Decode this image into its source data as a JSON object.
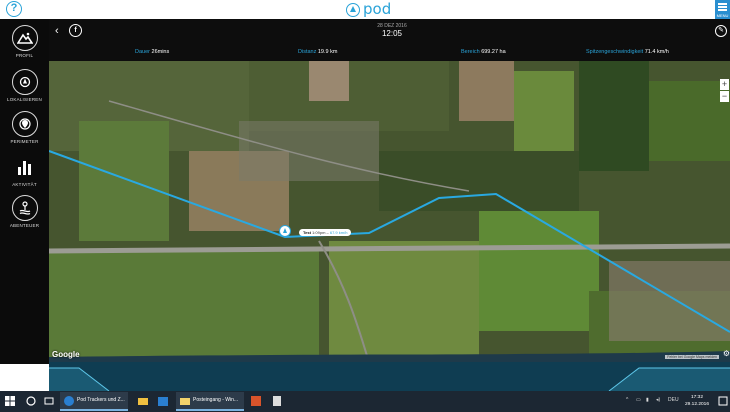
{
  "header": {
    "help_icon": "?",
    "brand": "pod",
    "menu_label": "MENU"
  },
  "sidebar": {
    "items": [
      {
        "label": "PROFIL",
        "icon": "profile-mountain-icon"
      },
      {
        "label": "LOKALISIEREN",
        "icon": "locate-pin-icon"
      },
      {
        "label": "PERIMETER",
        "icon": "perimeter-icon"
      },
      {
        "label": "AKTIVITÄT",
        "icon": "activity-bars-icon"
      },
      {
        "label": "ABENTEUER",
        "icon": "adventure-icon"
      }
    ]
  },
  "detail": {
    "back_icon": "‹",
    "share_icon": "f",
    "date": "28 DEZ 2016",
    "time": "12:05",
    "edit_icon": "✎",
    "stats": [
      {
        "label": "Dauer",
        "value": "26mins"
      },
      {
        "label": "Distanz",
        "value": "19.9 km"
      },
      {
        "label": "Bereich",
        "value": "699.27 ha"
      },
      {
        "label": "Spitzengeschwindigkeit",
        "value": "71.4 km/h"
      }
    ]
  },
  "map": {
    "zoom_in": "+",
    "zoom_out": "−",
    "google": "Google",
    "credits": "Fehler bei Google Maps melden",
    "settings_icon": "⚙",
    "track_color": "#29a9e1",
    "point": {
      "name": "Test",
      "time": "1:09pm",
      "speed": "67.9 km/h"
    }
  },
  "taskbar": {
    "apps": [
      {
        "label": "Pod Trackers und Z..."
      },
      {
        "label": "Posteingang - Win..."
      }
    ],
    "tray_lang": "DEU",
    "clock_time": "17:32",
    "clock_date": "29.12.2016"
  },
  "colors": {
    "accent": "#2aa3d8",
    "sidebar_bg": "#0b0b0b",
    "taskbar_bg": "#1c2733",
    "profile_bg": "#1a5a73"
  }
}
